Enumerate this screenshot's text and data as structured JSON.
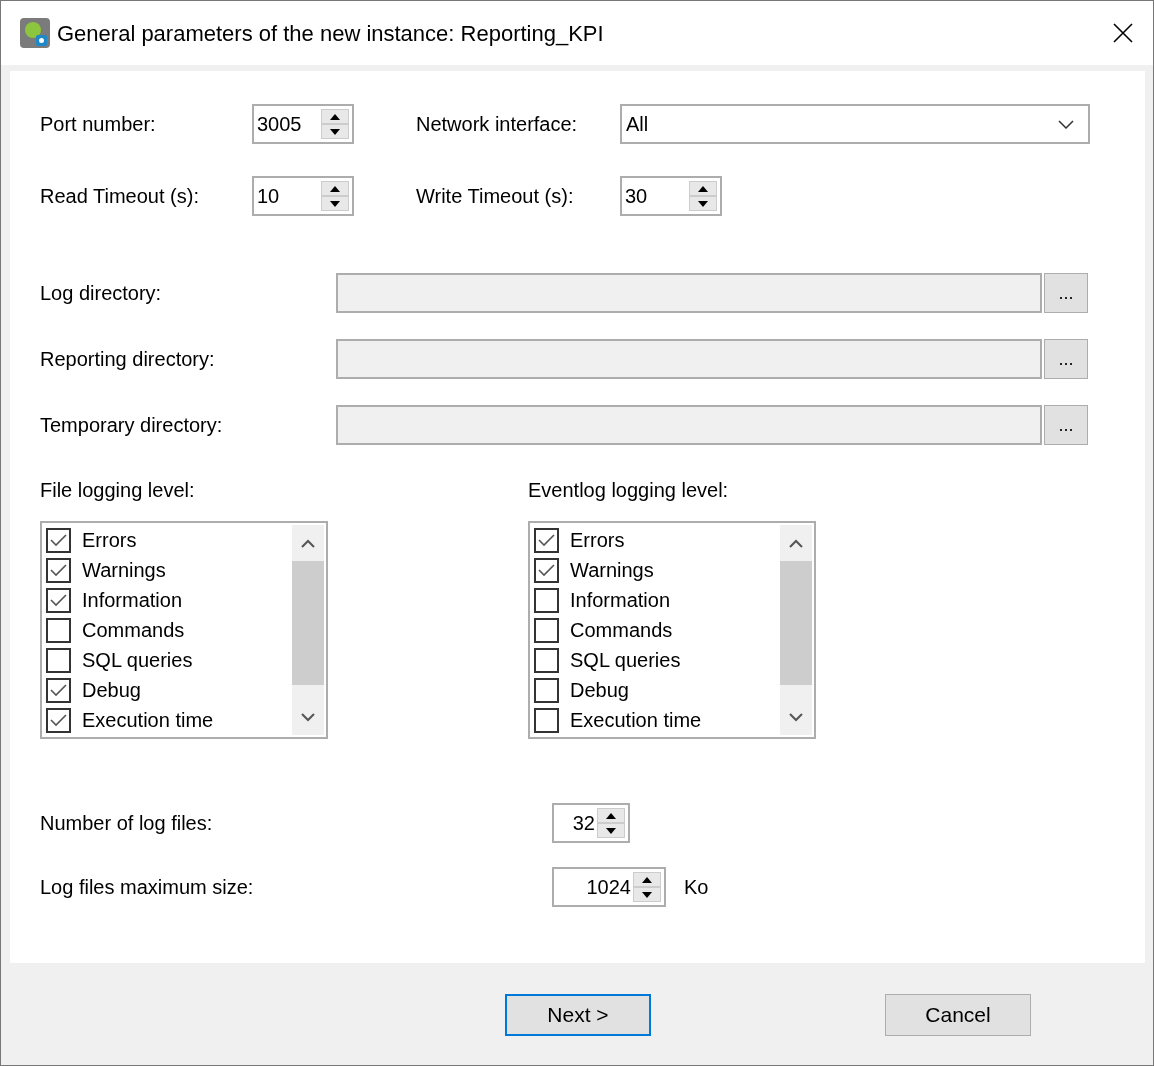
{
  "window": {
    "title": "General parameters of the new instance: Reporting_KPI"
  },
  "port": {
    "label": "Port number:",
    "value": "3005"
  },
  "network_interface": {
    "label": "Network interface:",
    "value": "All"
  },
  "read_timeout": {
    "label": "Read Timeout (s):",
    "value": "10"
  },
  "write_timeout": {
    "label": "Write Timeout (s):",
    "value": "30"
  },
  "directories": [
    {
      "label": "Log directory:",
      "button": "..."
    },
    {
      "label": "Reporting directory:",
      "button": "..."
    },
    {
      "label": "Temporary directory:",
      "button": "..."
    }
  ],
  "logging_levels": [
    {
      "title": "File logging level:",
      "items": [
        {
          "label": "Errors",
          "checked": true
        },
        {
          "label": "Warnings",
          "checked": true
        },
        {
          "label": "Information",
          "checked": true
        },
        {
          "label": "Commands",
          "checked": false
        },
        {
          "label": "SQL queries",
          "checked": false
        },
        {
          "label": "Debug",
          "checked": true
        },
        {
          "label": "Execution time",
          "checked": true
        }
      ]
    },
    {
      "title": "Eventlog logging level:",
      "items": [
        {
          "label": "Errors",
          "checked": true
        },
        {
          "label": "Warnings",
          "checked": true
        },
        {
          "label": "Information",
          "checked": false
        },
        {
          "label": "Commands",
          "checked": false
        },
        {
          "label": "SQL queries",
          "checked": false
        },
        {
          "label": "Debug",
          "checked": false
        },
        {
          "label": "Execution time",
          "checked": false
        }
      ]
    }
  ],
  "log_files": {
    "label": "Number of log files:",
    "value": "32"
  },
  "log_size": {
    "label": "Log files maximum size:",
    "value": "1024",
    "unit": "Ko"
  },
  "buttons": [
    {
      "label": "Next >",
      "focused": true
    },
    {
      "label": "Cancel",
      "focused": false
    }
  ]
}
